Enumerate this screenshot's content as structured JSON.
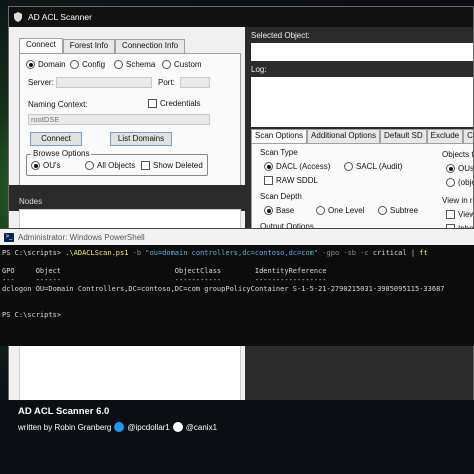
{
  "app": {
    "title": "AD ACL Scanner",
    "connect_tabs": [
      "Connect",
      "Forest Info",
      "Connection Info"
    ],
    "connect": {
      "radios": [
        "Domain",
        "Config",
        "Schema",
        "Custom"
      ],
      "server_label": "Server:",
      "port_label": "Port:",
      "naming_context_label": "Naming Context:",
      "credentials_label": "Credentials",
      "naming_context_value": "rootDSE",
      "connect_button": "Connect",
      "list_domains_button": "List Domains",
      "browse_options_label": "Browse Options",
      "browse_radios": [
        "OU's",
        "All Objects"
      ],
      "show_deleted_label": "Show Deleted"
    },
    "nodes_label": "Nodes",
    "selected_object_label": "Selected Object:",
    "log_label": "Log:",
    "scan_tabs": [
      "Scan Options",
      "Additional Options",
      "Default SD",
      "Exclude",
      "Compa"
    ],
    "scan_options": {
      "scan_type_label": "Scan Type",
      "dacl_label": "DACL (Access)",
      "sacl_label": "SACL (Audit)",
      "raw_sddl_label": "RAW SDDL",
      "scan_depth_label": "Scan Depth",
      "depth_radios": [
        "Base",
        "One Level",
        "Subtree"
      ],
      "output_options_label": "Output Options",
      "objects_to_label": "Objects to",
      "ous_label": "OUs",
      "object_partial": "(object",
      "view_in_report_label": "View in report",
      "view_partial": "View",
      "inherit_partial": "Inheri"
    }
  },
  "powershell": {
    "title": "Administrator: Windows PowerShell",
    "command": {
      "prompt": "PS C:\\scripts> ",
      "cmd": ".\\ADACLScan.ps1",
      "p1": " -b ",
      "str": "\"ou=domain controllers,dc=contoso,dc=com\"",
      "p2": " -gpo -sb -c ",
      "arg": "critical",
      "pipe": " | ",
      "ft": "ft"
    },
    "header": "GPO     Object                           ObjectClass        IdentityReference",
    "separator": "---     ------                           -----------        -----------------",
    "row": "dclogon OU=Domain Controllers,DC=contoso,DC=com groupPolicyContainer S-1-5-21-2790215031-3985095115-33687",
    "prompt2": "PS C:\\scripts> "
  },
  "footer": {
    "title": "AD ACL Scanner 6.0",
    "written_by": "written by Robin Granberg",
    "twitter": "@ipcdollar1",
    "github": "@canix1"
  },
  "colors": {
    "ps_background": "#0c0c0c",
    "ps_cmd": "#f2f24a",
    "ps_string": "#56b6e6",
    "twitter_blue": "#1d9bf0"
  },
  "icons": [
    "app-shield-icon",
    "powershell-icon",
    "twitter-icon",
    "github-icon"
  ]
}
